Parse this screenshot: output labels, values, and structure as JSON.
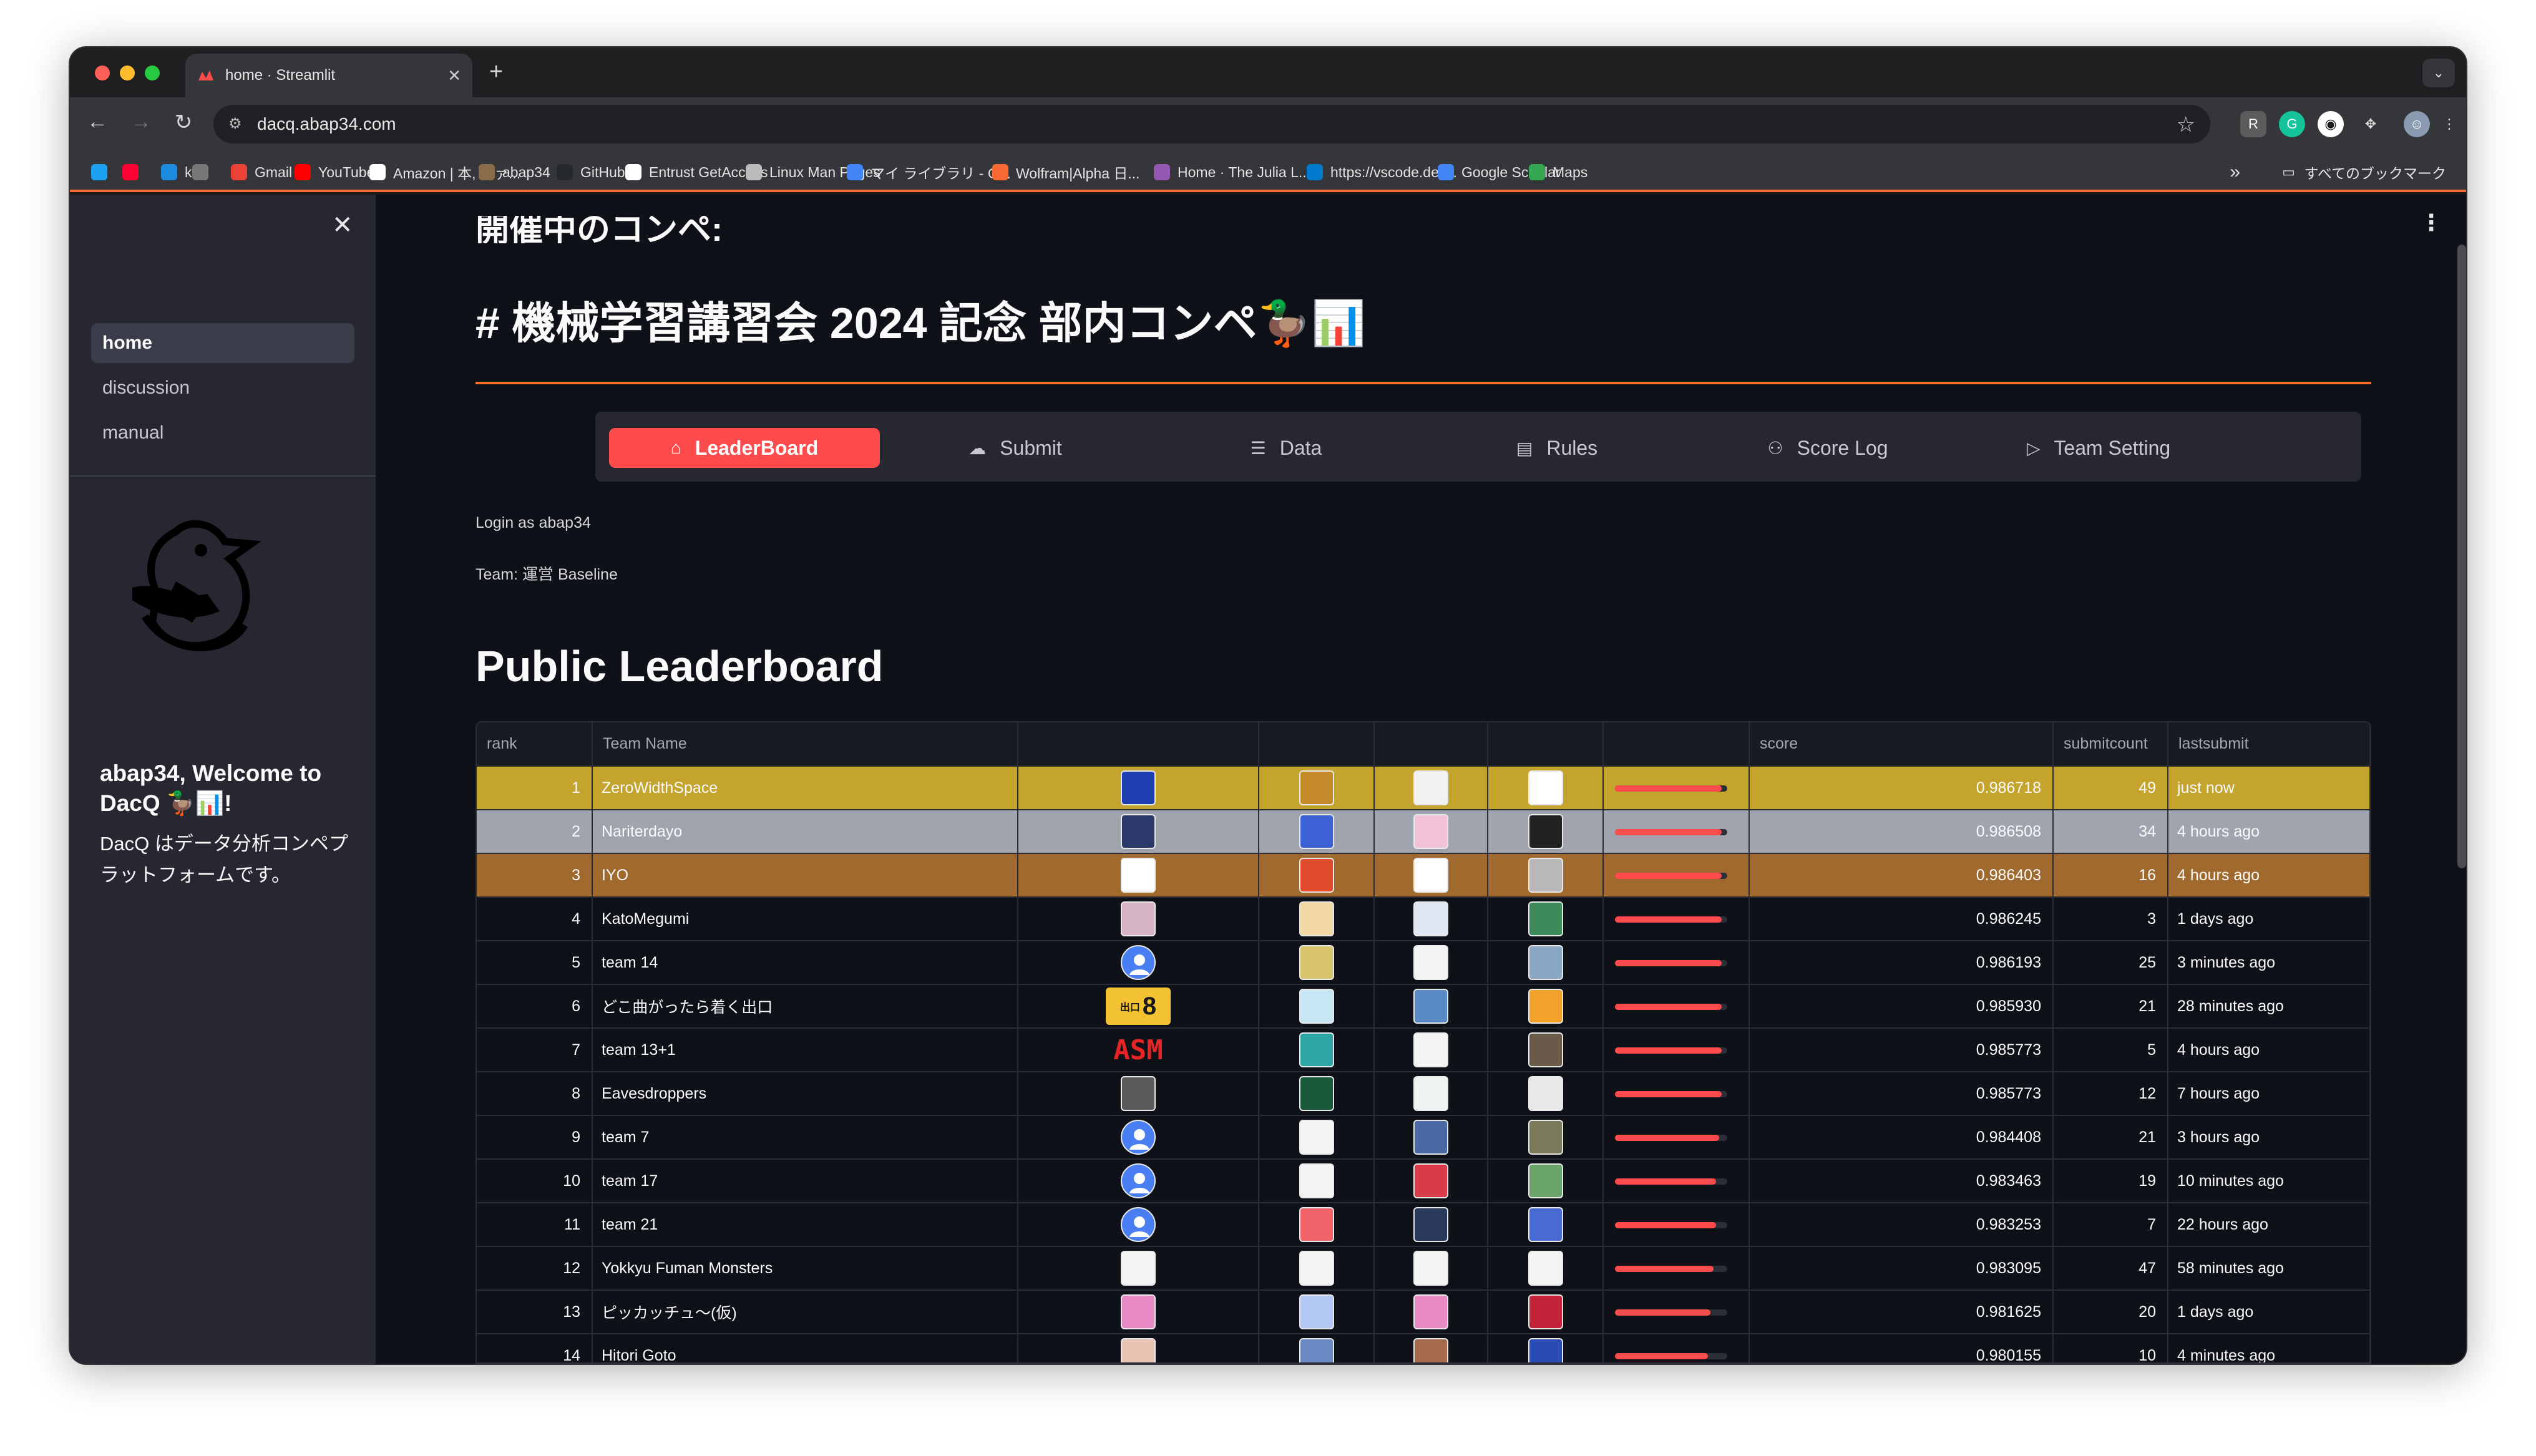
{
  "browser": {
    "tab_title": "home · Streamlit",
    "url": "dacq.abap34.com",
    "bookmarks": [
      {
        "label": "",
        "icon": "twitter-icon",
        "color": "#1da1f2"
      },
      {
        "label": "",
        "icon": "yahoo-icon",
        "color": "#ff0033"
      },
      {
        "label": "k",
        "icon": "k-icon",
        "color": "#1d8ce0"
      },
      {
        "label": "",
        "icon": "dots-icon",
        "color": "#777777"
      },
      {
        "label": "Gmail",
        "icon": "gmail-icon",
        "color": "#ea4335"
      },
      {
        "label": "YouTube",
        "icon": "youtube-icon",
        "color": "#ff0000"
      },
      {
        "label": "Amazon | 本, ファ...",
        "icon": "amazon-icon",
        "color": "#ffffff"
      },
      {
        "label": "abap34",
        "icon": "abap34-icon",
        "color": "#8a6b4a"
      },
      {
        "label": "GitHub",
        "icon": "github-icon",
        "color": "#24292e"
      },
      {
        "label": "Entrust GetAccess",
        "icon": "entrust-icon",
        "color": "#ffffff"
      },
      {
        "label": "Linux Man Pages",
        "icon": "globe-icon",
        "color": "#bbbbbb"
      },
      {
        "label": "マイ ライブラリ - G...",
        "icon": "library-icon",
        "color": "#4285f4"
      },
      {
        "label": "Wolfram|Alpha 日...",
        "icon": "wolfram-icon",
        "color": "#f96932"
      },
      {
        "label": "Home · The Julia L...",
        "icon": "julia-icon",
        "color": "#9558b2"
      },
      {
        "label": "https://vscode.dev...",
        "icon": "vscode-icon",
        "color": "#007acc"
      },
      {
        "label": "Google Scholar",
        "icon": "scholar-icon",
        "color": "#4285f4"
      },
      {
        "label": "Maps",
        "icon": "maps-icon",
        "color": "#34a853"
      }
    ],
    "all_bookmarks": "すべてのブックマーク",
    "overflow": "»"
  },
  "sidebar": {
    "nav": [
      "home",
      "discussion",
      "manual"
    ],
    "welcome": "abap34, Welcome to DacQ 🦆📊!",
    "description": "DacQ はデータ分析コンペプラットフォームです。"
  },
  "main": {
    "top_cut": "開催中のコンペ:",
    "title": "# 機械学習講習会 2024 記念 部内コンペ🦆📊",
    "menu": [
      {
        "label": "LeaderBoard",
        "icon": "home-icon",
        "glyph": "⌂"
      },
      {
        "label": "Submit",
        "icon": "cloud-upload-icon",
        "glyph": "☁"
      },
      {
        "label": "Data",
        "icon": "list-icon",
        "glyph": "☰"
      },
      {
        "label": "Rules",
        "icon": "document-icon",
        "glyph": "▤"
      },
      {
        "label": "Score Log",
        "icon": "people-icon",
        "glyph": "⚇"
      },
      {
        "label": "Team Setting",
        "icon": "play-icon",
        "glyph": "▷"
      }
    ],
    "active_menu": 0,
    "login_text": "Login as abap34",
    "team_text": "Team: 運営 Baseline",
    "leaderboard_title": "Public Leaderboard",
    "accent": "#ff4b4b"
  },
  "leaderboard": {
    "columns": [
      "rank",
      "Team Name",
      "",
      "",
      "",
      "",
      "",
      "score",
      "submitcount",
      "lastsubmit"
    ],
    "rows": [
      {
        "rank": "1",
        "name": "ZeroWidthSpace",
        "score": "0.986718",
        "count": "49",
        "last": "just now",
        "bar": 0.95,
        "avatars": [
          "#1f3fb0",
          "#c58a2a",
          "#f2f2f2",
          "#ffffff"
        ]
      },
      {
        "rank": "2",
        "name": "Nariterdayo",
        "score": "0.986508",
        "count": "34",
        "last": "4 hours ago",
        "bar": 0.95,
        "avatars": [
          "#2b3a6b",
          "#3c62d6",
          "#f3c3d8",
          "#222222"
        ]
      },
      {
        "rank": "3",
        "name": "IYO",
        "score": "0.986403",
        "count": "16",
        "last": "4 hours ago",
        "bar": 0.95,
        "avatars": [
          "#ffffff",
          "#e24b2c",
          "#ffffff",
          "#b8b8b8"
        ]
      },
      {
        "rank": "4",
        "name": "KatoMegumi",
        "score": "0.986245",
        "count": "3",
        "last": "1 days ago",
        "bar": 0.95,
        "avatars": [
          "#d7b4c4",
          "#f3d7a4",
          "#dfe7f3",
          "#3f8a5a"
        ]
      },
      {
        "rank": "5",
        "name": "team 14",
        "score": "0.986193",
        "count": "25",
        "last": "3 minutes ago",
        "bar": 0.95,
        "avatars": [
          "#4a7ff3",
          "#d8c46a",
          "#f4f4f4",
          "#8aa8c4"
        ]
      },
      {
        "rank": "6",
        "name": "どこ曲がったら着く出口",
        "score": "0.985930",
        "count": "21",
        "last": "28 minutes ago",
        "bar": 0.95,
        "avatars": [
          "#f2c230",
          "#c6e6f3",
          "#5a8ac4",
          "#f2a12a"
        ]
      },
      {
        "rank": "7",
        "name": "team 13+1",
        "score": "0.985773",
        "count": "5",
        "last": "4 hours ago",
        "bar": 0.95,
        "avatars": [
          "#111111",
          "#2fa6a6",
          "#f4f4f4",
          "#6a5a4a"
        ]
      },
      {
        "rank": "8",
        "name": "Eavesdroppers",
        "score": "0.985773",
        "count": "12",
        "last": "7 hours ago",
        "bar": 0.95,
        "avatars": [
          "#5a5a5a",
          "#1a5a3a",
          "#eef4f4",
          "#e8e8e8"
        ]
      },
      {
        "rank": "9",
        "name": "team 7",
        "score": "0.984408",
        "count": "21",
        "last": "3 hours ago",
        "bar": 0.93,
        "avatars": [
          "#4a7ff3",
          "#f4f4f4",
          "#4a6aa4",
          "#7a7a5a"
        ]
      },
      {
        "rank": "10",
        "name": "team 17",
        "score": "0.983463",
        "count": "19",
        "last": "10 minutes ago",
        "bar": 0.9,
        "avatars": [
          "#4a7ff3",
          "#f4f4f4",
          "#d83a4a",
          "#6aa46a"
        ]
      },
      {
        "rank": "11",
        "name": "team 21",
        "score": "0.983253",
        "count": "7",
        "last": "22 hours ago",
        "bar": 0.9,
        "avatars": [
          "#4a7ff3",
          "#f2646a",
          "#2a3a5a",
          "#4a6ad4"
        ]
      },
      {
        "rank": "12",
        "name": "Yokkyu Fuman Monsters",
        "score": "0.983095",
        "count": "47",
        "last": "58 minutes ago",
        "bar": 0.88,
        "avatars": [
          "#f4f4f4",
          "#f4f4f4",
          "#f4f4f4",
          "#f4f4f4"
        ]
      },
      {
        "rank": "13",
        "name": "ピッカッチュ〜(仮)",
        "score": "0.981625",
        "count": "20",
        "last": "1 days ago",
        "bar": 0.85,
        "avatars": [
          "#e88ac4",
          "#b4c8f4",
          "#e88ac4",
          "#c4243a"
        ]
      },
      {
        "rank": "14",
        "name": "Hitori Goto",
        "score": "0.980155",
        "count": "10",
        "last": "4 minutes ago",
        "bar": 0.83,
        "avatars": [
          "#e8c4b4",
          "#6a8ac4",
          "#a46a4a",
          "#2a4ab4"
        ]
      }
    ],
    "special": {
      "exit8": "8",
      "exit_label": "出口",
      "asm": "ASM"
    }
  }
}
